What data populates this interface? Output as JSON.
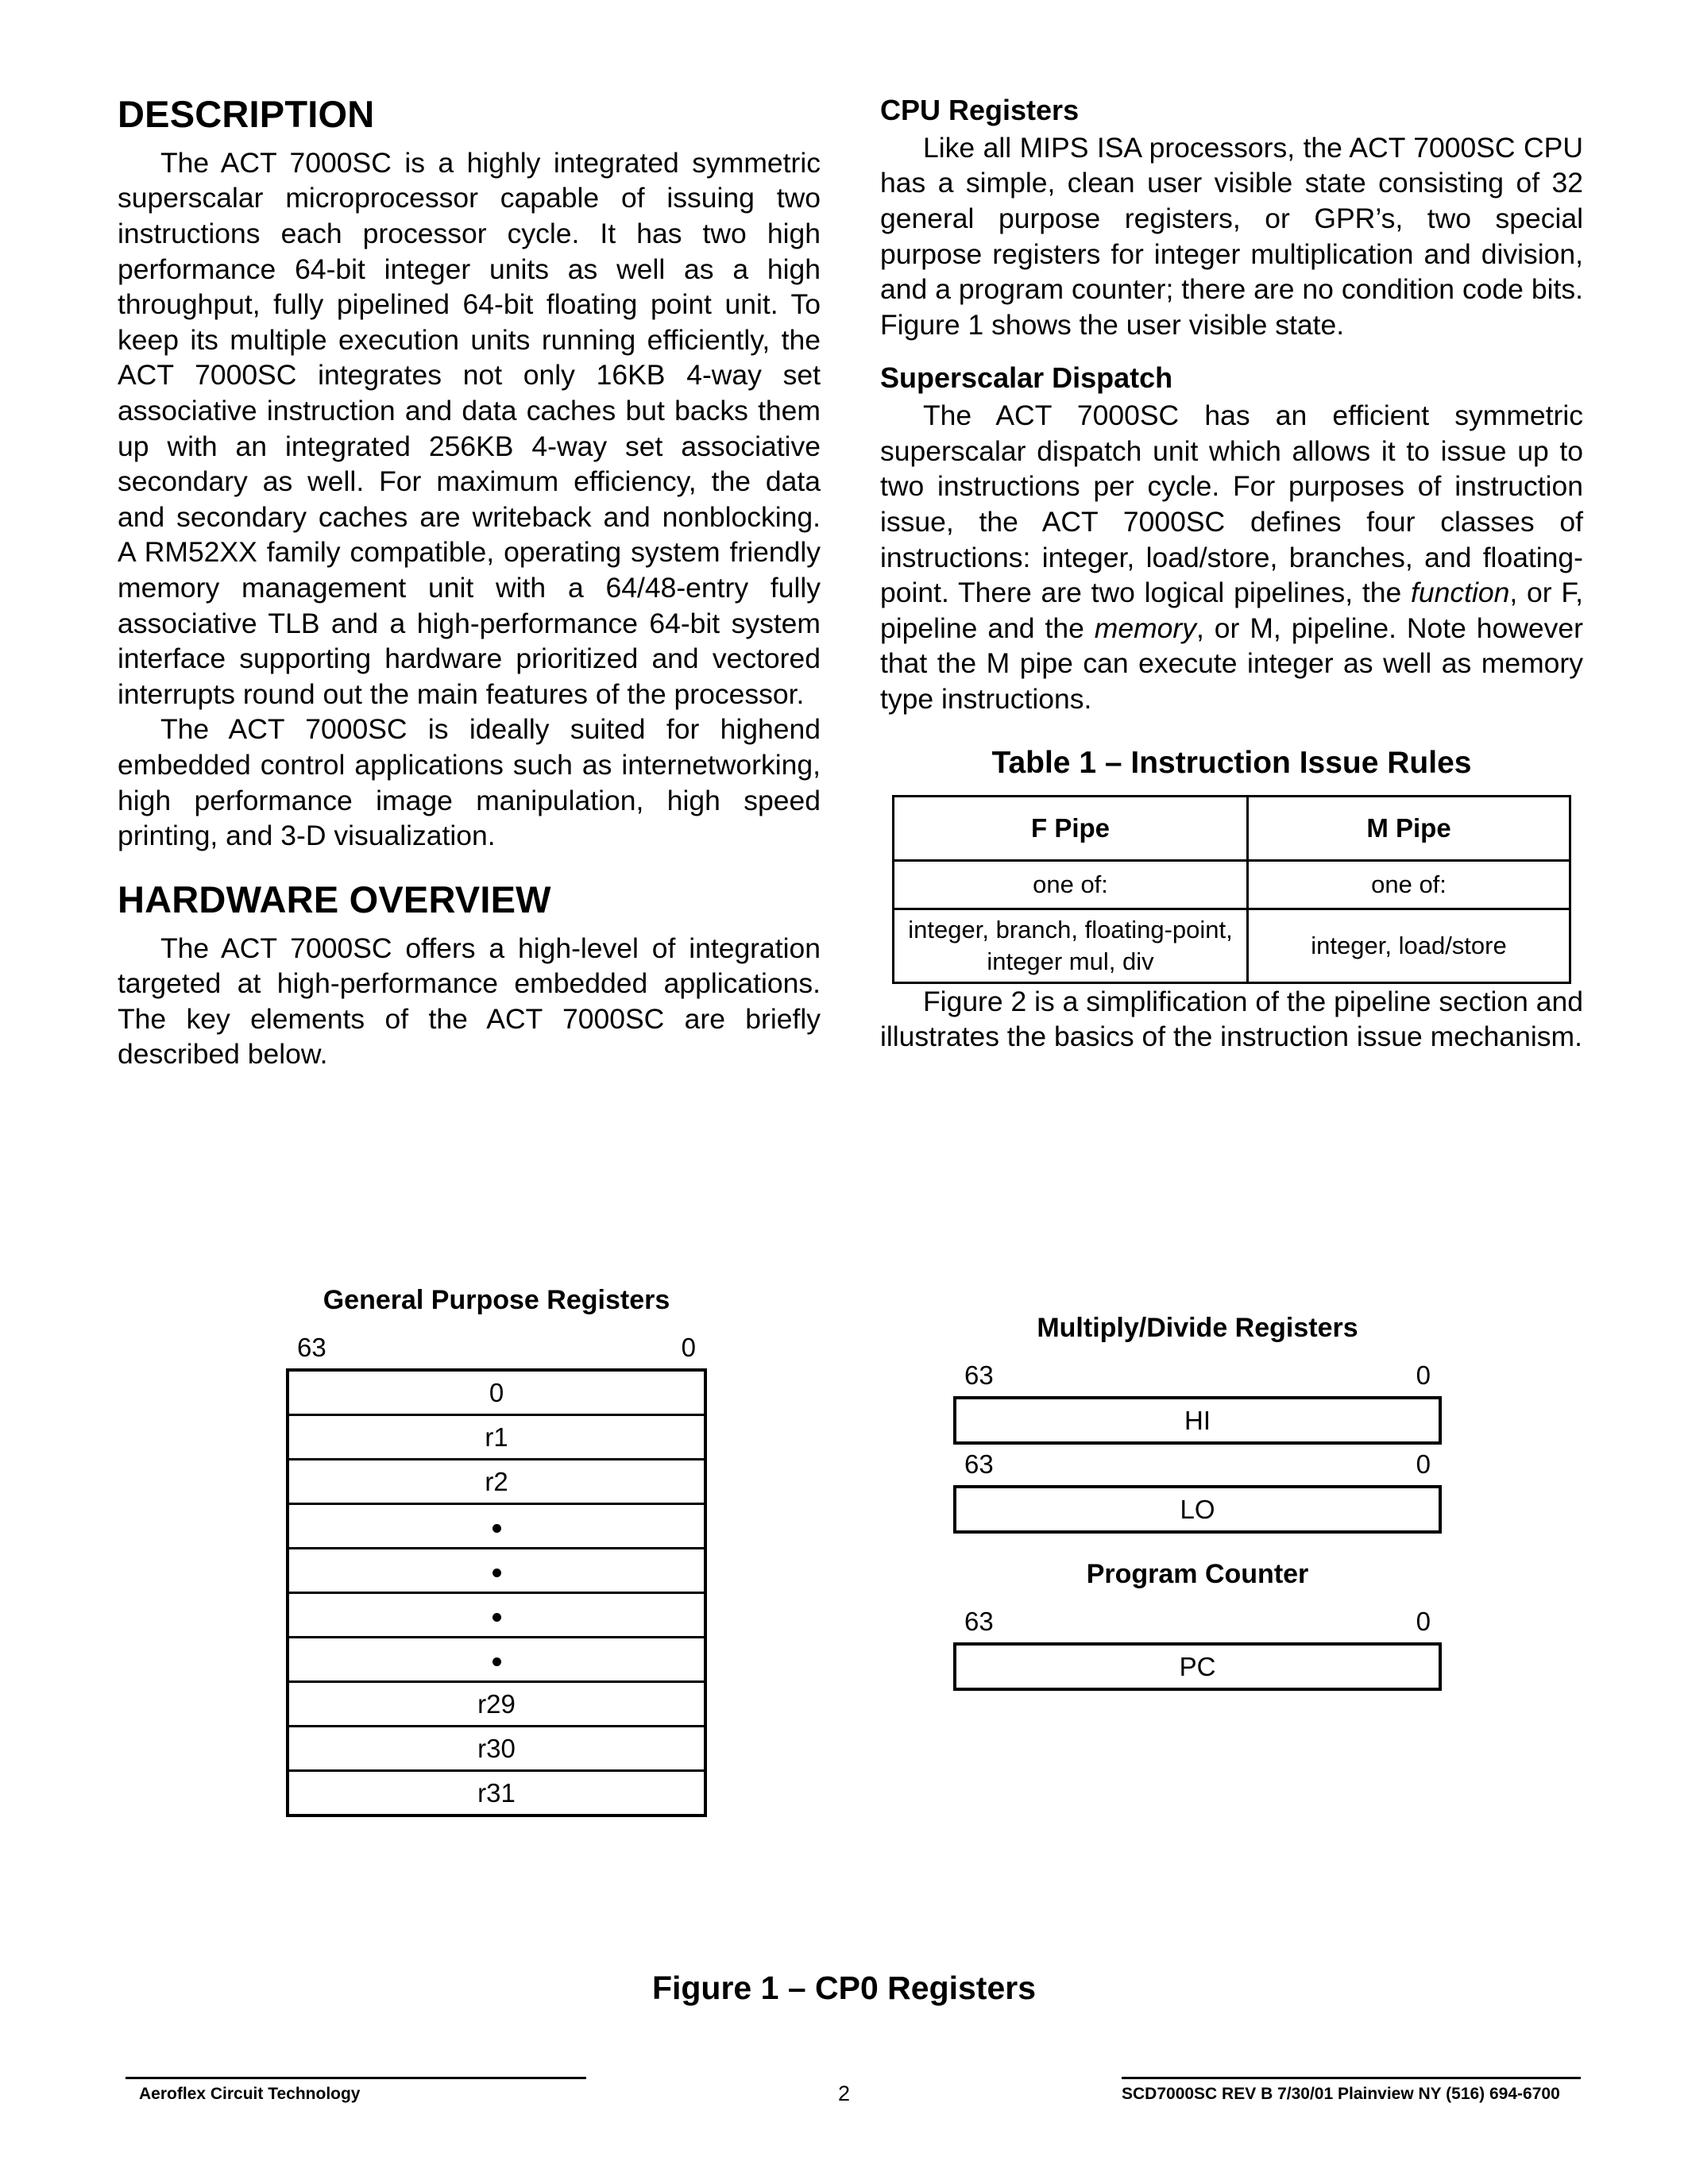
{
  "left_column": {
    "heading_description": "DESCRIPTION",
    "paragraph_1": "The ACT 7000SC is a highly integrated symmetric superscalar microprocessor capable of issuing two instructions each processor cycle. It has two high performance 64-bit integer units as well as a high throughput, fully pipelined 64-bit floating point unit. To keep its multiple execution units running efficiently, the ACT 7000SC integrates not only 16KB 4-way set associative instruction and data caches but backs them up with an integrated 256KB 4-way set associative secondary as well. For maximum efficiency, the data and secondary caches are writeback and nonblocking. A RM52XX family compatible, operating system friendly memory management unit with a 64/48-entry fully associative TLB and a high-performance 64-bit system interface supporting hardware prioritized and vectored interrupts round out the main features of the processor.",
    "paragraph_2": "The ACT 7000SC is ideally suited for highend embedded control applications such as internetworking, high performance image manipulation, high speed printing, and 3-D visualization.",
    "heading_hardware": "HARDWARE OVERVIEW",
    "paragraph_3": "The ACT 7000SC offers a high-level of integration targeted at high-performance embedded applications. The key elements of the ACT 7000SC are briefly described below."
  },
  "right_column": {
    "heading_cpu_registers": "CPU Registers",
    "paragraph_cpu": "Like all MIPS ISA processors, the ACT 7000SC CPU has a simple, clean user visible state consisting of 32 general purpose registers, or GPR’s, two special purpose registers for integer multiplication and division, and a program counter; there are no condition code bits. Figure 1 shows the user visible state.",
    "heading_superscalar": "Superscalar Dispatch",
    "paragraph_superscalar_a": "The ACT 7000SC has an efficient symmetric superscalar dispatch unit which allows it to issue up to two instructions per cycle. For purposes of instruction issue, the ACT 7000SC defines four classes of instructions: integer, load/store, branches, and floating-point. There are two logical pipelines, the ",
    "paragraph_superscalar_italic_1": "function",
    "paragraph_superscalar_b": ", or F, pipeline and the ",
    "paragraph_superscalar_italic_2": "memory",
    "paragraph_superscalar_c": ", or M, pipeline. Note however that the M pipe can execute integer as well as memory type instructions.",
    "paragraph_figure2": "Figure 2 is a simplification of the pipeline section and illustrates the basics of the instruction issue mechanism."
  },
  "table1": {
    "title": "Table 1 – Instruction Issue Rules",
    "headers": [
      "F Pipe",
      "M Pipe"
    ],
    "rows": [
      [
        "one of:",
        "one of:"
      ],
      [
        "integer, branch, floating-point,\ninteger mul, div",
        "integer, load/store"
      ]
    ],
    "row2_f_line1": "integer, branch, floating-point,",
    "row2_f_line2": "integer mul, div",
    "row2_m": "integer, load/store"
  },
  "figure": {
    "caption": "Figure 1 – CP0 Registers",
    "gpr": {
      "title": "General Purpose Registers",
      "bit_high": "63",
      "bit_low": "0",
      "cells": [
        "0",
        "r1",
        "r2",
        "•",
        "•",
        "•",
        "•",
        "r29",
        "r30",
        "r31"
      ]
    },
    "muldiv": {
      "title": "Multiply/Divide Registers",
      "hi_bit_high": "63",
      "hi_bit_low": "0",
      "hi_label": "HI",
      "lo_bit_high": "63",
      "lo_bit_low": "0",
      "lo_label": "LO"
    },
    "pc": {
      "title": "Program Counter",
      "bit_high": "63",
      "bit_low": "0",
      "label": "PC"
    }
  },
  "footer": {
    "company": "Aeroflex Circuit Technology",
    "page_number": "2",
    "document_ref": "SCD7000SC REV B  7/30/01 Plainview NY (516) 694-6700"
  }
}
